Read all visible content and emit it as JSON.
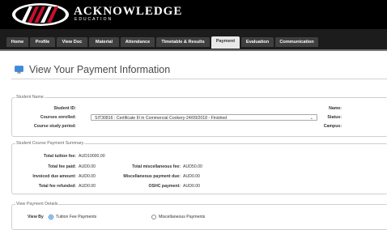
{
  "brand": {
    "name": "ACKNOWLEDGE",
    "subtitle": "EDUCATION"
  },
  "nav": {
    "tabs": [
      {
        "label": "Home",
        "active": false
      },
      {
        "label": "Profile",
        "active": false
      },
      {
        "label": "View Doc",
        "active": false
      },
      {
        "label": "Material",
        "active": false
      },
      {
        "label": "Attendance",
        "active": false
      },
      {
        "label": "Timetable & Results",
        "active": false
      },
      {
        "label": "Payment",
        "active": true
      },
      {
        "label": "Evaluation",
        "active": false
      },
      {
        "label": "Communication",
        "active": false
      }
    ]
  },
  "page": {
    "title": "View Your Payment Information",
    "title_icon": "monitor-icon"
  },
  "student_name": {
    "legend": "Student Name",
    "student_id_label": "Student ID:",
    "student_id_value": "",
    "courses_enrolled_label": "Courses enrolled:",
    "courses_enrolled_value": "SIT30816 : Certificate III in Commercial Cookery-24/09/2018 - Finished",
    "course_period_label": "Course study period:",
    "course_period_value": "",
    "name_label": "Name:",
    "status_label": "Status:",
    "campus_label": "Campus:"
  },
  "payment_summary": {
    "legend": "Student Course Payment Summary",
    "total_tuition_label": "Total tuition fee:",
    "total_tuition_value": "AUD10000.00",
    "total_fee_paid_label": "Total fee paid:",
    "total_fee_paid_value": "AUD0.00",
    "total_misc_label": "Total miscellaneous fee:",
    "total_misc_value": "AUD50.00",
    "invoiced_due_label": "Invoiced due amount:",
    "invoiced_due_value": "AUD0.00",
    "misc_due_label": "Miscellaneous payment due:",
    "misc_due_value": "AUD0.00",
    "total_refunded_label": "Total fee refunded:",
    "total_refunded_value": "AUD0.00",
    "oshc_label": "OSHC payment:",
    "oshc_value": "AUD0.00"
  },
  "payment_details": {
    "legend": "View Payment Details",
    "view_by_label": "View By",
    "option_tuition": "Tuition Fee Payments",
    "option_misc": "Miscellaneous Payments",
    "selected": "tuition"
  },
  "colors": {
    "header_bg": "#000000",
    "nav_bg": "#1c1c1c",
    "tab_bg": "#3f3f3f",
    "tab_active_bg": "#e9e9e9",
    "accent": "#1a6fd9",
    "logo_red": "#c8102e"
  }
}
